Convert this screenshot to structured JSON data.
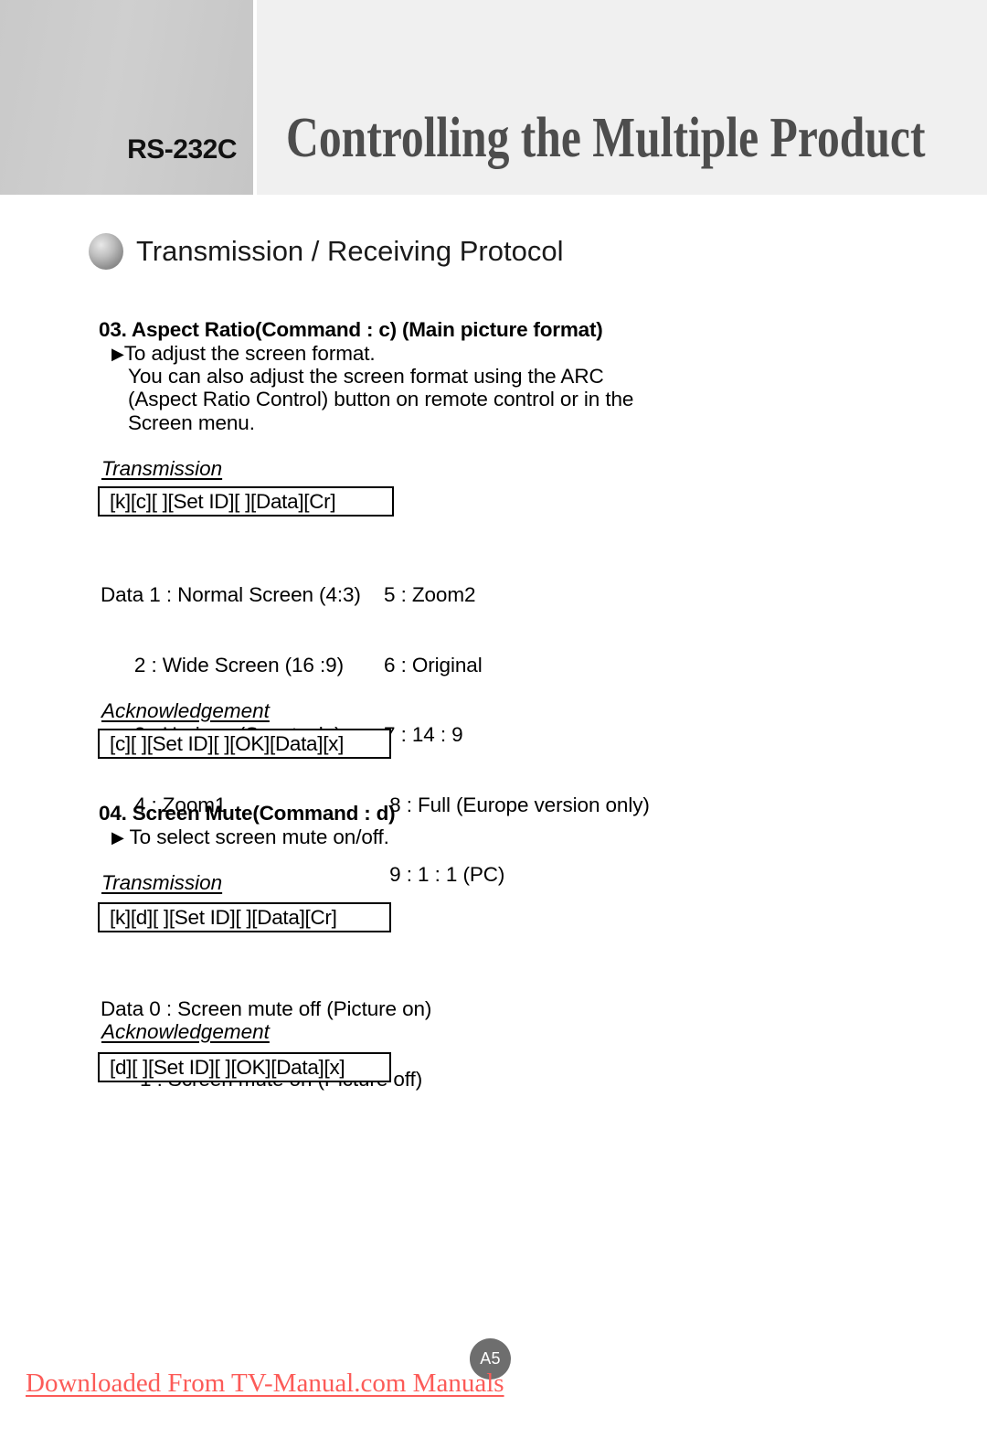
{
  "header": {
    "left_label": "RS-232C",
    "title": "Controlling the Multiple Product"
  },
  "protocol_heading": {
    "bullet_icon": "sphere-bullet-icon",
    "text": "Transmission / Receiving Protocol"
  },
  "sections": [
    {
      "number_title": "03. Aspect Ratio(Command : c) (Main picture format)",
      "bullet": "▶",
      "description_lines": [
        "To adjust the screen format.",
        "You can also adjust the screen format using the ARC",
        "(Aspect Ratio Control) button on remote control or in the",
        "Screen menu."
      ],
      "transmission_label": "Transmission",
      "transmission_code": "[k][c][ ][Set ID][ ][Data][Cr]",
      "data_left": [
        "Data 1 : Normal Screen (4:3)",
        "      2 : Wide Screen (16 :9)",
        "      3 : Horizon (Spectacle)",
        "      4 : Zoom1"
      ],
      "data_right": [
        "5 : Zoom2",
        "6 : Original",
        "7 : 14 : 9",
        " 8 : Full (Europe version only)",
        " 9 : 1 : 1 (PC)"
      ],
      "acknowledgement_label": "Acknowledgement",
      "acknowledgement_code": "[c][ ][Set ID][ ][OK][Data][x]"
    },
    {
      "number_title": "04. Screen Mute(Command : d)",
      "bullet": "▶",
      "description_lines": [
        " To select screen mute on/off."
      ],
      "transmission_label": "Transmission",
      "transmission_code": "[k][d][ ][Set ID][ ][Data][Cr]",
      "data_left": [
        "Data 0 : Screen mute off (Picture on)",
        "       1 : Screen mute on (Picture off)"
      ],
      "acknowledgement_label": "Acknowledgement",
      "acknowledgement_code": "[d][ ][Set ID][ ][OK][Data][x]"
    }
  ],
  "footer": {
    "page_number": "A5",
    "watermark": "Downloaded From TV-Manual.com Manuals"
  }
}
